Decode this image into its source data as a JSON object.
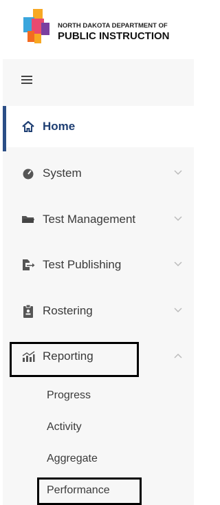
{
  "logo": {
    "line1": "NORTH DAKOTA DEPARTMENT OF",
    "line2": "PUBLIC INSTRUCTION",
    "colors": [
      "#f7a823",
      "#e84a6f",
      "#3aa6dd",
      "#7a3fa0",
      "#f36b21"
    ]
  },
  "sidebar": {
    "menu_icon": "hamburger-icon",
    "items": [
      {
        "label": "Home",
        "icon": "home-icon"
      },
      {
        "label": "System",
        "icon": "gauge-icon"
      },
      {
        "label": "Test Management",
        "icon": "folder-icon"
      },
      {
        "label": "Test Publishing",
        "icon": "publish-icon"
      },
      {
        "label": "Rostering",
        "icon": "clipboard-icon"
      },
      {
        "label": "Reporting",
        "icon": "chart-icon"
      }
    ],
    "reporting_subitems": [
      "Progress",
      "Activity",
      "Aggregate",
      "Performance"
    ]
  },
  "colors": {
    "active": "#1f3f73",
    "accent_bar": "#2b4e86",
    "sidebar_bg": "#f7f7f7"
  }
}
